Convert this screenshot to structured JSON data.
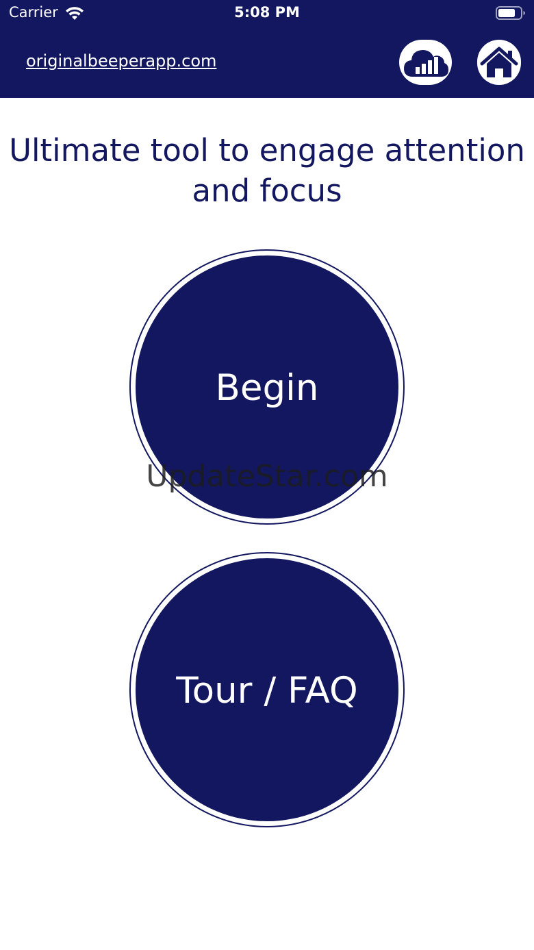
{
  "status_bar": {
    "carrier": "Carrier",
    "time": "5:08 PM"
  },
  "header": {
    "link_text": "originalbeeperapp.com",
    "icons": [
      "cloud-chart-icon",
      "home-icon"
    ]
  },
  "main": {
    "tagline": "Ultimate tool to engage attention and focus",
    "begin_label": "Begin",
    "faq_label": "Tour / FAQ"
  },
  "watermark": "UpdateStar.com",
  "colors": {
    "primary": "#12175f",
    "background": "#ffffff"
  }
}
